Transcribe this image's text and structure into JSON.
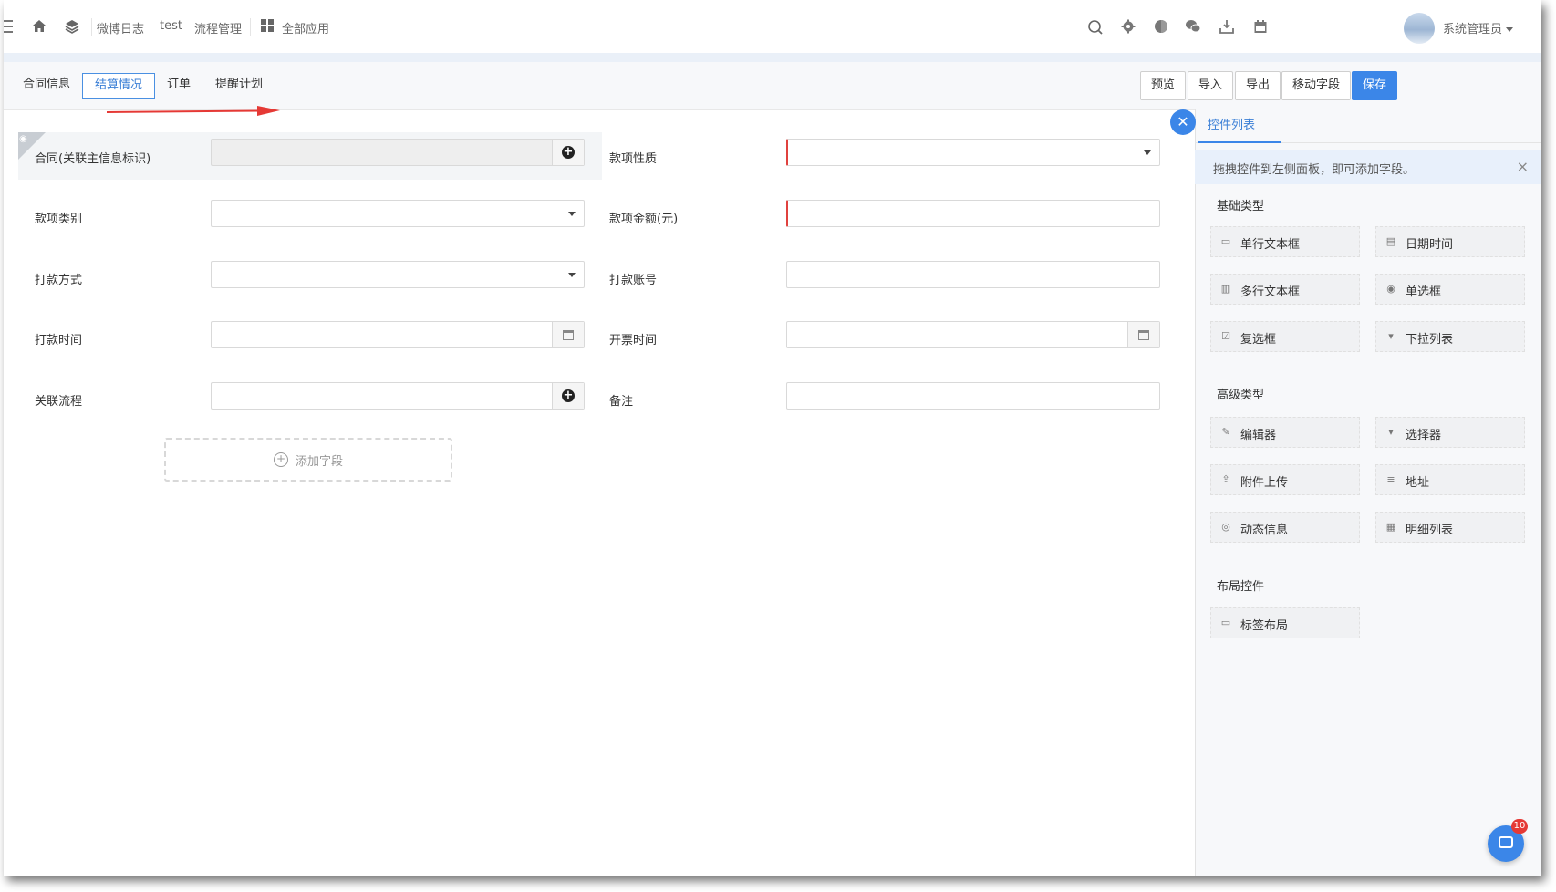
{
  "nav": {
    "links": [
      "微博日志",
      "test",
      "流程管理",
      "全部应用"
    ],
    "user": "系统管理员"
  },
  "tabs": [
    "合同信息",
    "结算情况",
    "订单",
    "提醒计划"
  ],
  "active_tab": "结算情况",
  "toolbar": {
    "preview": "预览",
    "import": "导入",
    "export": "导出",
    "move_field": "移动字段",
    "save": "保存"
  },
  "form": {
    "contract_label": "合同(关联主信息标识)",
    "nature_label": "款项性质",
    "category_label": "款项类别",
    "amount_label": "款项金额(元)",
    "pay_method_label": "打款方式",
    "account_label": "打款账号",
    "pay_time_label": "打款时间",
    "invoice_time_label": "开票时间",
    "flow_label": "关联流程",
    "remark_label": "备注",
    "add_field": "添加字段"
  },
  "panel": {
    "tab": "控件列表",
    "tip": "拖拽控件到左侧面板，即可添加字段。",
    "basic_title": "基础类型",
    "basic": [
      "单行文本框",
      "日期时间",
      "多行文本框",
      "单选框",
      "复选框",
      "下拉列表"
    ],
    "advanced_title": "高级类型",
    "advanced": [
      "编辑器",
      "选择器",
      "附件上传",
      "地址",
      "动态信息",
      "明细列表"
    ],
    "layout_title": "布局控件",
    "layout": [
      "标签布局"
    ]
  },
  "chat": {
    "badge": "10"
  },
  "colors": {
    "accent": "#3b86e8",
    "required": "#e0413e",
    "annotation_arrow": "#e53935"
  }
}
